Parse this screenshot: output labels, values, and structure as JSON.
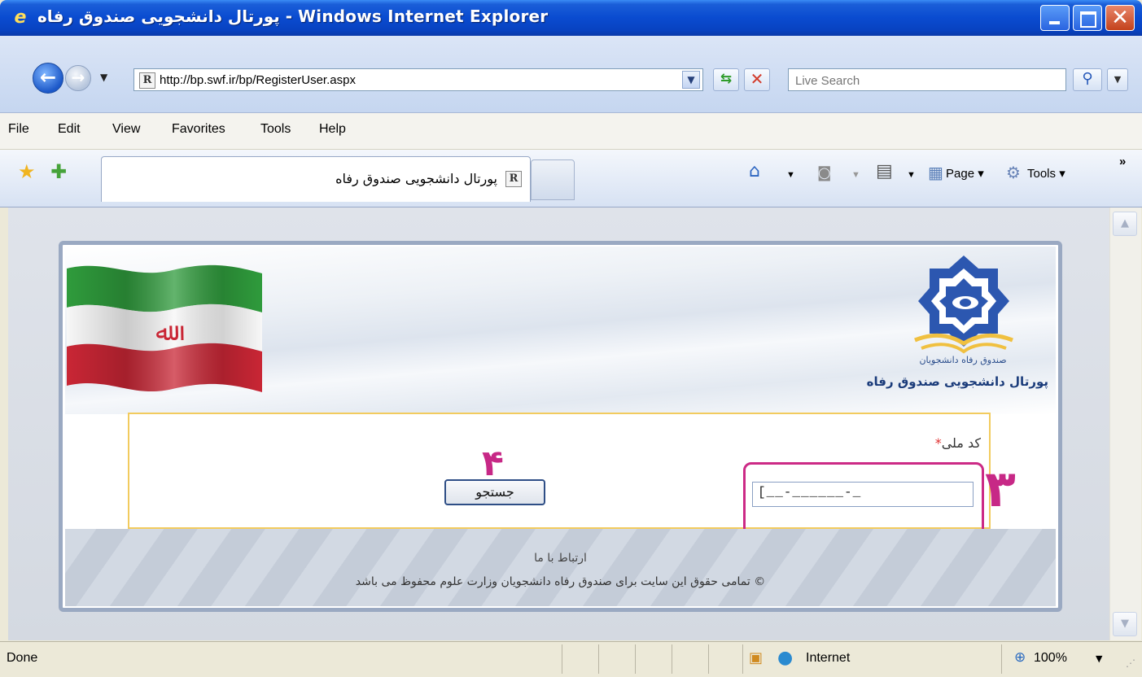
{
  "window": {
    "title": "پورتال دانشجویی صندوق رفاه - Windows Internet Explorer"
  },
  "address_bar": {
    "url": "http://bp.swf.ir/bp/RegisterUser.aspx",
    "search_placeholder": "Live Search"
  },
  "menu": {
    "items": [
      "File",
      "Edit",
      "View",
      "Favorites",
      "Tools",
      "Help"
    ]
  },
  "tabs": {
    "active_title": "پورتال دانشجویی صندوق رفاه"
  },
  "command_bar": {
    "page_label": "Page",
    "tools_label": "Tools"
  },
  "header": {
    "logo_caption": "صندوق رفاه دانشجویان",
    "portal_name": "پورتال دانشجویی صندوق رفاه"
  },
  "form": {
    "national_code_label": "کد ملی",
    "required_mark": "*",
    "national_code_value": "[__-______-_",
    "search_button": "جستجو"
  },
  "annotations": {
    "step_input": "۳",
    "step_button": "۴"
  },
  "footer": {
    "contact": "ارتباط با ما",
    "copyright": "© تمامی حقوق این سایت برای صندوق رفاه دانشجویان وزارت علوم محفوظ می باشد"
  },
  "status_bar": {
    "status": "Done",
    "zone": "Internet",
    "zoom": "100%"
  },
  "colors": {
    "title_bar": "#0a4bd0",
    "annotation": "#c72886",
    "form_border": "#f2cb5e",
    "panel_border": "#9aa9c2"
  }
}
